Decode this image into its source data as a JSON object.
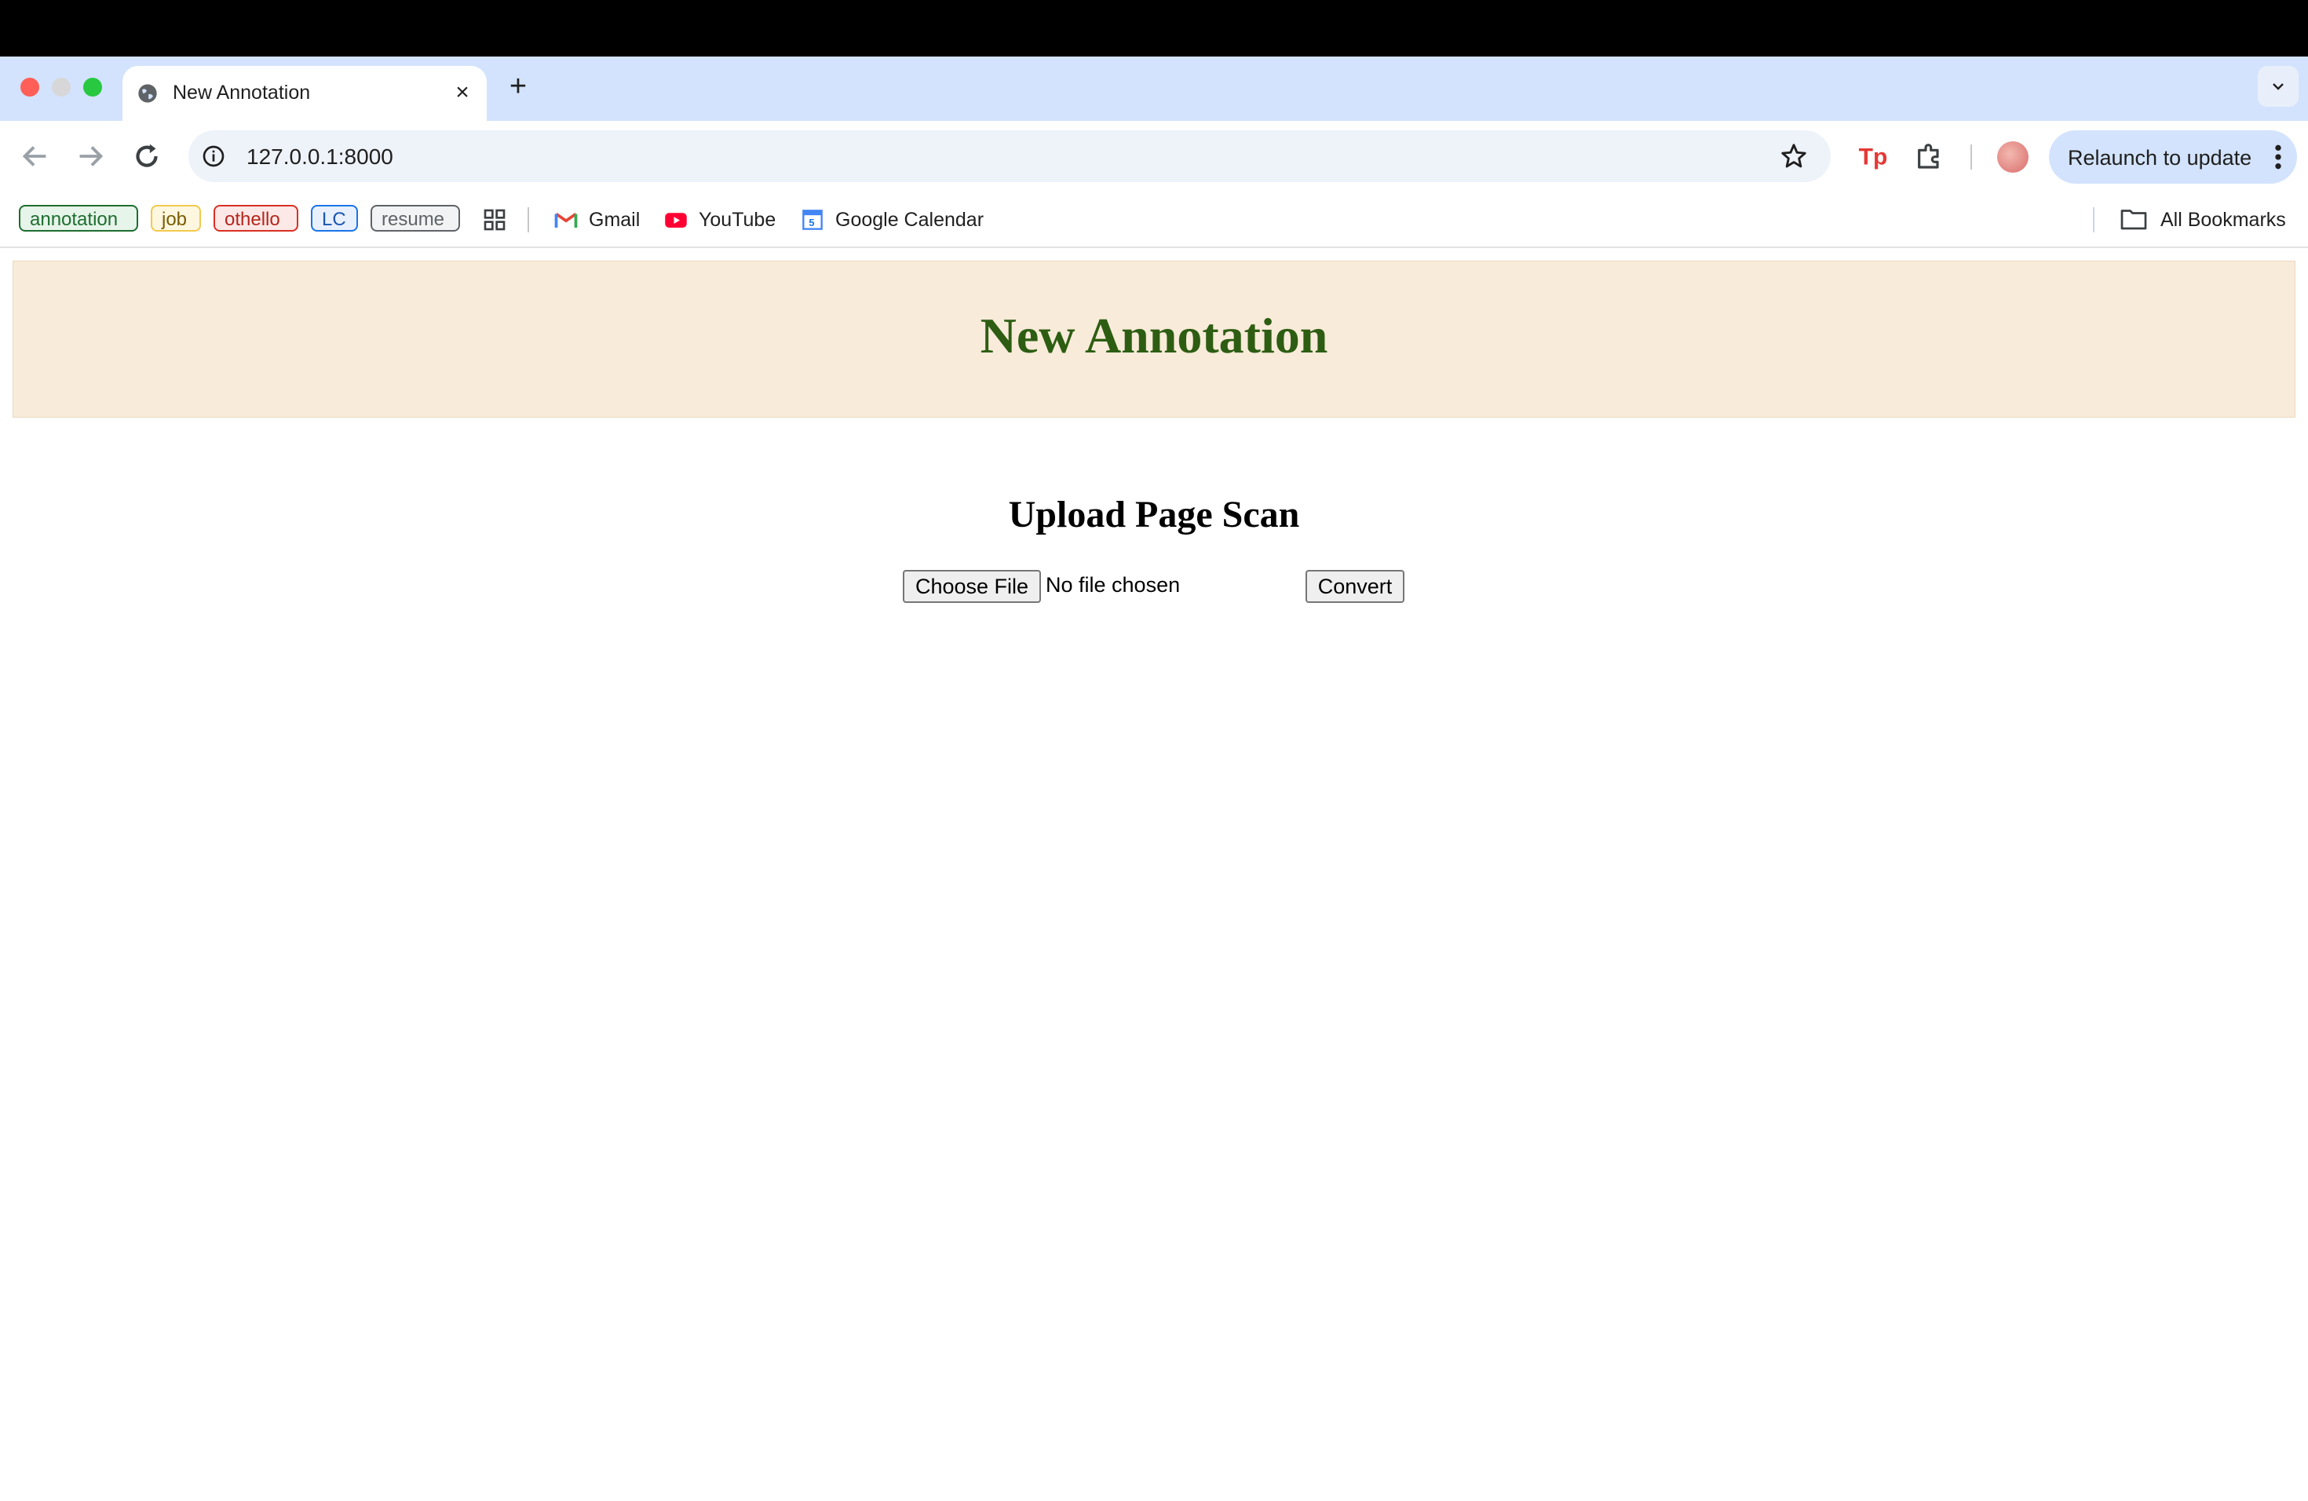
{
  "browser": {
    "tab": {
      "title": "New Annotation"
    },
    "url": "127.0.0.1:8000",
    "relaunch_label": "Relaunch to update",
    "bookmarks": {
      "chips": [
        {
          "label": "annotation",
          "color": "#1e6e2f",
          "bg": "#e6f4ea"
        },
        {
          "label": "job",
          "color": "#7a5c00",
          "bg": "#fef7e0"
        },
        {
          "label": "othello",
          "color": "#b3261e",
          "bg": "#fce8e6"
        },
        {
          "label": "LC",
          "color": "#1a56b0",
          "bg": "#e8f0fe"
        },
        {
          "label": "resume",
          "color": "#5f6368",
          "bg": "#f1f3f4"
        }
      ],
      "links": [
        {
          "label": "Gmail",
          "icon": "gmail-icon"
        },
        {
          "label": "YouTube",
          "icon": "youtube-icon"
        },
        {
          "label": "Google Calendar",
          "icon": "calendar-icon"
        }
      ],
      "all_bookmarks_label": "All Bookmarks"
    }
  },
  "page": {
    "banner_title": "New Annotation",
    "section_title": "Upload Page Scan",
    "choose_file_label": "Choose File",
    "no_file_text": "No file chosen",
    "convert_label": "Convert"
  },
  "colors": {
    "banner_bg": "#f8ebd9",
    "banner_title": "#2d5d12",
    "tabstrip_bg": "#d3e3fd"
  }
}
